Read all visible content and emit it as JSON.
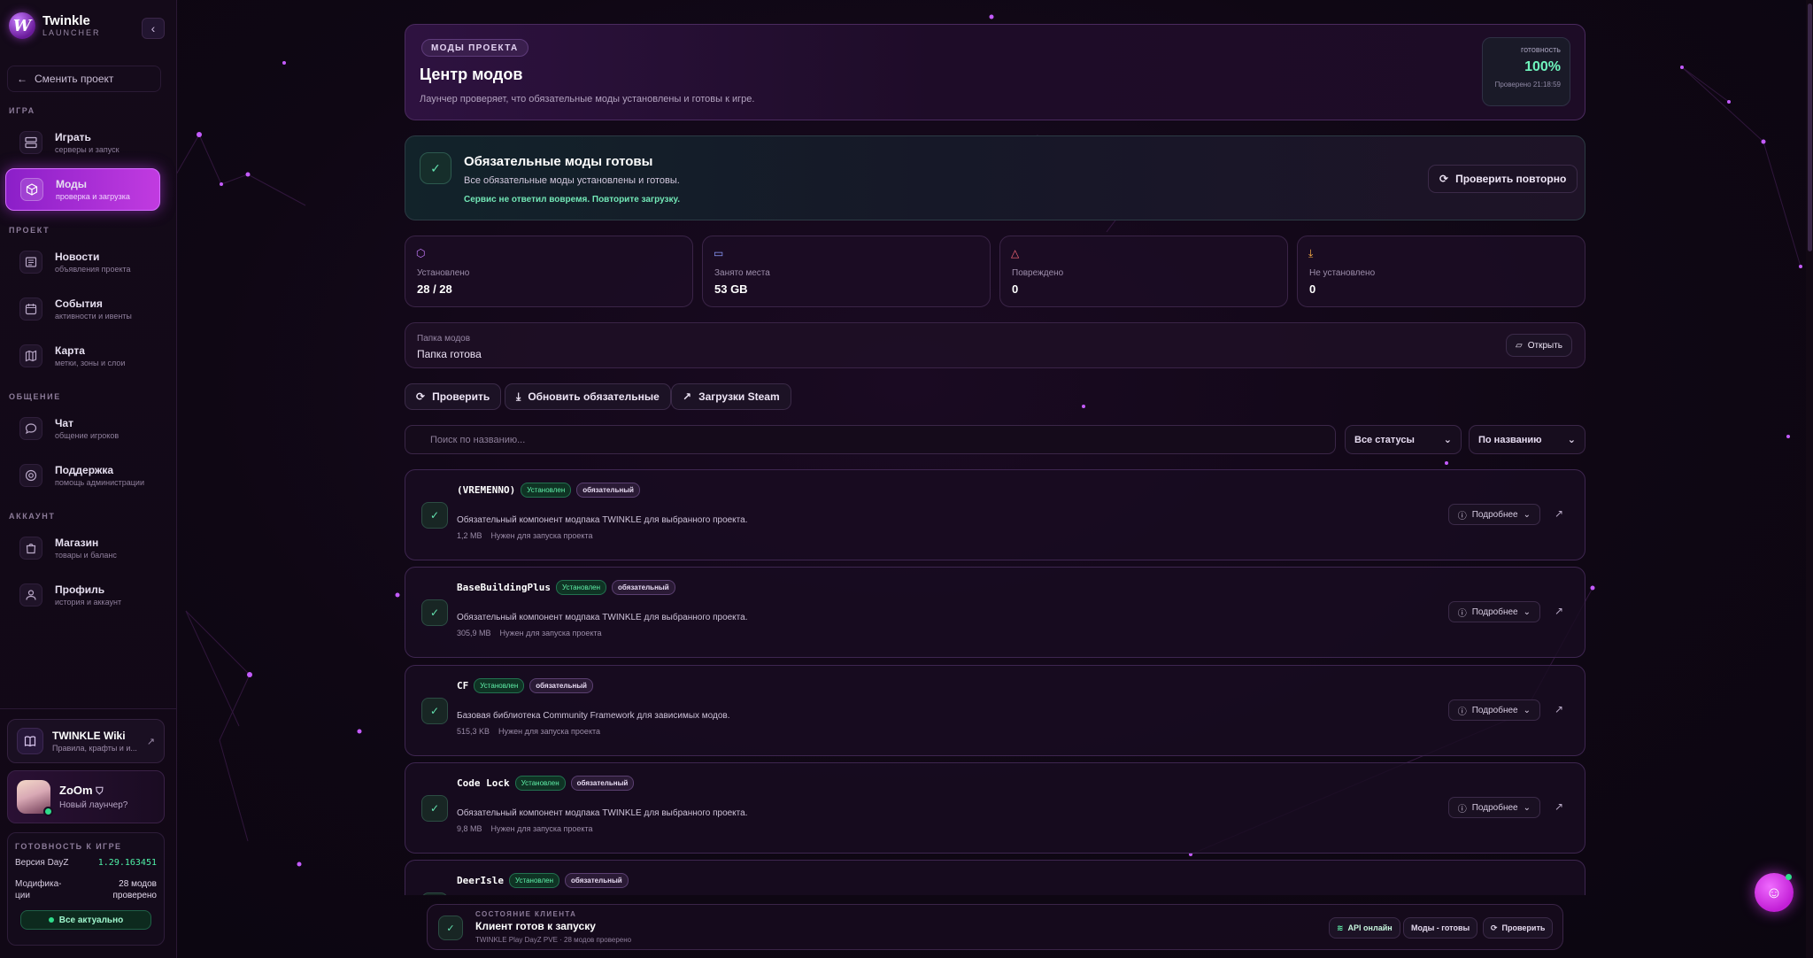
{
  "brand": {
    "name": "Twinkle",
    "sub": "LAUNCHER",
    "logo_letter": "W"
  },
  "sidebar": {
    "collapse_icon": "chevron-left-icon",
    "switch_project": "Сменить проект",
    "sections": {
      "game": "ИГРА",
      "project": "ПРОЕКТ",
      "social": "ОБЩЕНИЕ",
      "account": "АККАУНТ"
    },
    "items": [
      {
        "title": "Играть",
        "sub": "серверы и запуск",
        "icon": "server-icon"
      },
      {
        "title": "Моды",
        "sub": "проверка и загрузка",
        "icon": "package-icon"
      },
      {
        "title": "Новости",
        "sub": "объявления проекта",
        "icon": "newspaper-icon"
      },
      {
        "title": "События",
        "sub": "активности и ивенты",
        "icon": "calendar-icon"
      },
      {
        "title": "Карта",
        "sub": "метки, зоны и слои",
        "icon": "map-icon"
      },
      {
        "title": "Чат",
        "sub": "общение игроков",
        "icon": "chat-icon"
      },
      {
        "title": "Поддержка",
        "sub": "помощь администрации",
        "icon": "lifebuoy-icon"
      },
      {
        "title": "Магазин",
        "sub": "товары и баланс",
        "icon": "shop-icon"
      },
      {
        "title": "Профиль",
        "sub": "история и аккаунт",
        "icon": "user-icon"
      }
    ],
    "wiki": {
      "title": "TWINKLE Wiki",
      "sub": "Правила, крафты и и..."
    },
    "user": {
      "name": "ZoOm",
      "sub": "Новый лаунчер?"
    },
    "readiness": {
      "title": "ГОТОВНОСТЬ К ИГРЕ",
      "version_label": "Версия DayZ",
      "version_value": "1.29.163451",
      "mods_label": "Модифика-ции",
      "mods_value": "28 модов проверено",
      "badge": "Все актуально"
    }
  },
  "hero": {
    "pill": "МОДЫ ПРОЕКТА",
    "title": "Центр модов",
    "subtitle": "Лаунчер проверяет, что обязательные моды установлены и готовы к игре.",
    "readiness_label": "готовность",
    "readiness_value": "100%",
    "checked_at": "Проверено 21:18:59"
  },
  "status": {
    "title": "Обязательные моды готовы",
    "subtitle": "Все обязательные моды установлены и готовы.",
    "warning": "Сервис не ответил вовремя. Повторите загрузку.",
    "recheck_button": "Проверить повторно"
  },
  "stats": [
    {
      "label": "Установлено",
      "value": "28 / 28",
      "icon": "package-icon",
      "color": "#c77dff"
    },
    {
      "label": "Занято места",
      "value": "53 GB",
      "icon": "hard-drive-icon",
      "color": "#8c9cff"
    },
    {
      "label": "Повреждено",
      "value": "0",
      "icon": "warning-icon",
      "color": "#ff6b7a"
    },
    {
      "label": "Не установлено",
      "value": "0",
      "icon": "download-icon",
      "color": "#ffb347"
    }
  ],
  "folder": {
    "label": "Папка модов",
    "value": "Папка готова",
    "open_button": "Открыть"
  },
  "actions": {
    "check": "Проверить",
    "update_required": "Обновить обязательные",
    "steam_downloads": "Загрузки Steam"
  },
  "filters": {
    "search_placeholder": "Поиск по названию...",
    "status_select": "Все статусы",
    "sort_select": "По названию"
  },
  "mods": [
    {
      "name": "(VREMENNO)",
      "status": "Установлен",
      "tag": "обязательный",
      "desc": "Обязательный компонент модпака TWINKLE для выбранного проекта.",
      "size": "1,2 MB",
      "note": "Нужен для запуска проекта"
    },
    {
      "name": "BaseBuildingPlus",
      "status": "Установлен",
      "tag": "обязательный",
      "desc": "Обязательный компонент модпака TWINKLE для выбранного проекта.",
      "size": "305,9 MB",
      "note": "Нужен для запуска проекта"
    },
    {
      "name": "CF",
      "status": "Установлен",
      "tag": "обязательный",
      "desc": "Базовая библиотека Community Framework для зависимых модов.",
      "size": "515,3 KB",
      "note": "Нужен для запуска проекта"
    },
    {
      "name": "Code Lock",
      "status": "Установлен",
      "tag": "обязательный",
      "desc": "Обязательный компонент модпака TWINKLE для выбранного проекта.",
      "size": "9,8 MB",
      "note": "Нужен для запуска проекта"
    },
    {
      "name": "DeerIsle",
      "status": "Установлен",
      "tag": "обязательный",
      "desc": "",
      "size": "",
      "note": ""
    }
  ],
  "mod_more_label": "Подробнее",
  "footer": {
    "label": "СОСТОЯНИЕ КЛИЕНТА",
    "title": "Клиент готов к запуску",
    "sub": "TWINKLE Play DayZ PVE · 28 модов проверено",
    "api_chip": "API онлайн",
    "mods_chip": "Моды - готовы",
    "check_chip": "Проверить"
  }
}
